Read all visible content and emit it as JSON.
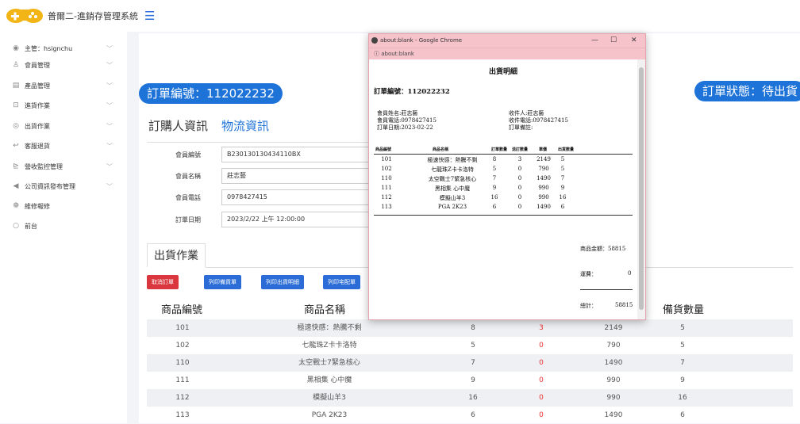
{
  "app": {
    "title": "普爾二-進銷存管理系統"
  },
  "sidebar": {
    "items": [
      {
        "icon": "user-icon",
        "glyph": "◉",
        "label": "主管：hsignchu"
      },
      {
        "icon": "members-icon",
        "glyph": "♙",
        "label": "會員管理"
      },
      {
        "icon": "product-icon",
        "glyph": "▤",
        "label": "產品管理"
      },
      {
        "icon": "inbound-icon",
        "glyph": "⊡",
        "label": "進貨作業"
      },
      {
        "icon": "outbound-icon",
        "glyph": "◎",
        "label": "出貨作業"
      },
      {
        "icon": "return-icon",
        "glyph": "↩",
        "label": "客服退貨"
      },
      {
        "icon": "monitor-icon",
        "glyph": "⊵",
        "label": "營收監控管理"
      },
      {
        "icon": "publish-icon",
        "glyph": "◀",
        "label": "公司資訊發布管理"
      },
      {
        "icon": "repair-icon",
        "glyph": "❁",
        "label": "維修報修"
      },
      {
        "icon": "frontend-icon",
        "glyph": "○",
        "label": "前台"
      }
    ]
  },
  "order": {
    "number_label": "訂單編號：112022232",
    "status_label": "訂單狀態：待出貨"
  },
  "tabs": {
    "buyer": "訂購人資訊",
    "logistics": "物流資訊"
  },
  "form": {
    "fields": [
      {
        "label": "會員編號",
        "value": "B230130130434110BX"
      },
      {
        "label": "會員名稱",
        "value": "莊志藝"
      },
      {
        "label": "會員電話",
        "value": "0978427415"
      },
      {
        "label": "訂單日期",
        "value": "2023/2/22 上午 12:00:00"
      }
    ]
  },
  "shipping": {
    "tab": "出貨作業",
    "buttons": {
      "cancel": "取消訂單",
      "print_prep": "列印備貨單",
      "print_detail": "列印出貨明細",
      "print_delivery": "列印宅配單"
    },
    "headers": {
      "id": "商品編號",
      "name": "商品名稱",
      "prep": "備貨數量"
    },
    "rows": [
      {
        "id": "101",
        "name": "極速快感：熱騰不剩",
        "qty": "8",
        "returned": "3",
        "price": "2149",
        "prep": "5"
      },
      {
        "id": "102",
        "name": "七龍珠Z卡卡洛特",
        "qty": "5",
        "returned": "0",
        "price": "790",
        "prep": "5"
      },
      {
        "id": "110",
        "name": "太空戰士7緊急核心",
        "qty": "7",
        "returned": "0",
        "price": "1490",
        "prep": "7"
      },
      {
        "id": "111",
        "name": "黑相集 心中魔",
        "qty": "9",
        "returned": "0",
        "price": "990",
        "prep": "9"
      },
      {
        "id": "112",
        "name": "模擬山羊3",
        "qty": "16",
        "returned": "0",
        "price": "990",
        "prep": "16"
      },
      {
        "id": "113",
        "name": "PGA 2K23",
        "qty": "6",
        "returned": "0",
        "price": "1490",
        "prep": "6"
      }
    ]
  },
  "popup": {
    "window_title": "about:blank - Google Chrome",
    "url": "about:blank",
    "doc_title": "出貨明細",
    "order_no": "訂單編號：112022232",
    "member_name": "會員姓名:莊志藝",
    "member_phone": "會員電話:0978427415",
    "order_date": "訂單日期:2023-02-22",
    "recipient": "收件人:莊志藝",
    "recipient_phone": "收件電話:0978427415",
    "remark": "訂單備註:",
    "headers": [
      "商品編號",
      "商品名稱",
      "訂單數量",
      "退訂數量",
      "單價",
      "出貨數量"
    ],
    "rows": [
      [
        "101",
        "極速快感：熱騰不剩",
        "8",
        "3",
        "2149",
        "5"
      ],
      [
        "102",
        "七龍珠Z卡卡洛特",
        "5",
        "0",
        "790",
        "5"
      ],
      [
        "110",
        "太空戰士7緊急核心",
        "7",
        "0",
        "1490",
        "7"
      ],
      [
        "111",
        "黑相集 心中魔",
        "9",
        "0",
        "990",
        "9"
      ],
      [
        "112",
        "模擬山羊3",
        "16",
        "0",
        "990",
        "16"
      ],
      [
        "113",
        "PGA 2K23",
        "6",
        "0",
        "1490",
        "6"
      ]
    ],
    "goods_total": "商品金額：58815",
    "shipping_label": "運費：",
    "shipping_value": "0",
    "total_label": "總計：",
    "total_value": "58815"
  }
}
